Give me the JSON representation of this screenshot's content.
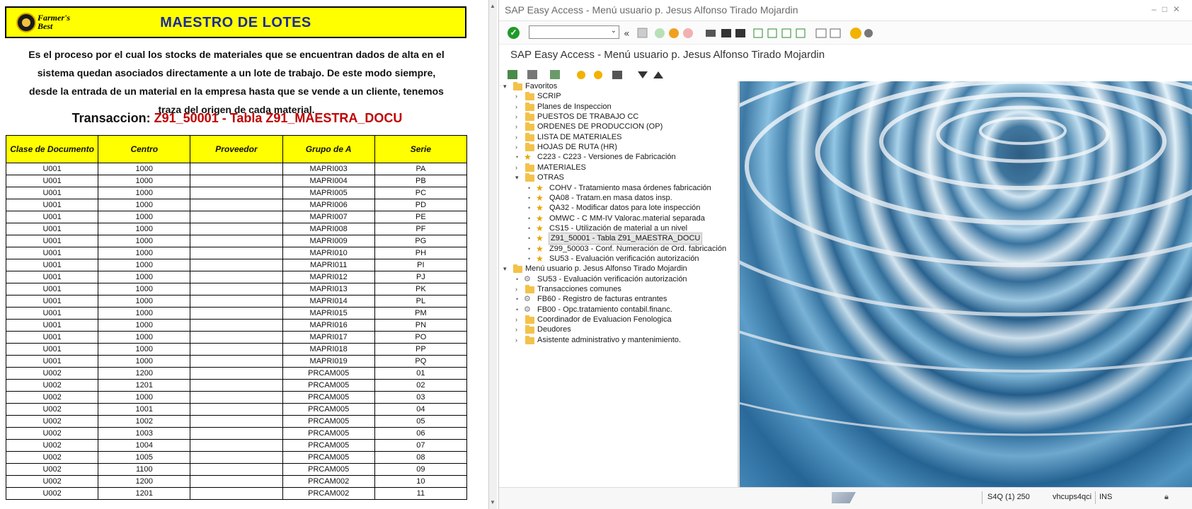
{
  "doc": {
    "logo_text": "Farmer's Best",
    "banner_title": "MAESTRO DE LOTES",
    "description_lines": [
      "Es el proceso por el cual los stocks de materiales que se encuentran dados de alta en el",
      "sistema quedan asociados directamente a un lote de trabajo. De este modo siempre,",
      "desde la entrada de un material en la empresa hasta que se vende a un cliente, tenemos",
      "traza del origen de cada material."
    ],
    "transaccion_label": "Transaccion: ",
    "transaccion_value": "Z91_50001 - Tabla Z91_MAESTRA_DOCU",
    "table": {
      "headers": [
        "Clase de Documento",
        "Centro",
        "Proveedor",
        "Grupo de A",
        "Serie"
      ],
      "rows": [
        [
          "U001",
          "1000",
          "",
          "MAPRI003",
          "PA"
        ],
        [
          "U001",
          "1000",
          "",
          "MAPRI004",
          "PB"
        ],
        [
          "U001",
          "1000",
          "",
          "MAPRI005",
          "PC"
        ],
        [
          "U001",
          "1000",
          "",
          "MAPRI006",
          "PD"
        ],
        [
          "U001",
          "1000",
          "",
          "MAPRI007",
          "PE"
        ],
        [
          "U001",
          "1000",
          "",
          "MAPRI008",
          "PF"
        ],
        [
          "U001",
          "1000",
          "",
          "MAPRI009",
          "PG"
        ],
        [
          "U001",
          "1000",
          "",
          "MAPRI010",
          "PH"
        ],
        [
          "U001",
          "1000",
          "",
          "MAPRI011",
          "PI"
        ],
        [
          "U001",
          "1000",
          "",
          "MAPRI012",
          "PJ"
        ],
        [
          "U001",
          "1000",
          "",
          "MAPRI013",
          "PK"
        ],
        [
          "U001",
          "1000",
          "",
          "MAPRI014",
          "PL"
        ],
        [
          "U001",
          "1000",
          "",
          "MAPRI015",
          "PM"
        ],
        [
          "U001",
          "1000",
          "",
          "MAPRI016",
          "PN"
        ],
        [
          "U001",
          "1000",
          "",
          "MAPRI017",
          "PO"
        ],
        [
          "U001",
          "1000",
          "",
          "MAPRI018",
          "PP"
        ],
        [
          "U001",
          "1000",
          "",
          "MAPRI019",
          "PQ"
        ],
        [
          "U002",
          "1200",
          "",
          "PRCAM005",
          "01"
        ],
        [
          "U002",
          "1201",
          "",
          "PRCAM005",
          "02"
        ],
        [
          "U002",
          "1000",
          "",
          "PRCAM005",
          "03"
        ],
        [
          "U002",
          "1001",
          "",
          "PRCAM005",
          "04"
        ],
        [
          "U002",
          "1002",
          "",
          "PRCAM005",
          "05"
        ],
        [
          "U002",
          "1003",
          "",
          "PRCAM005",
          "06"
        ],
        [
          "U002",
          "1004",
          "",
          "PRCAM005",
          "07"
        ],
        [
          "U002",
          "1005",
          "",
          "PRCAM005",
          "08"
        ],
        [
          "U002",
          "1100",
          "",
          "PRCAM005",
          "09"
        ],
        [
          "U002",
          "1200",
          "",
          "PRCAM002",
          "10"
        ],
        [
          "U002",
          "1201",
          "",
          "PRCAM002",
          "11"
        ]
      ]
    }
  },
  "sap": {
    "window_title": "SAP Easy Access  -  Menú usuario p. Jesus Alfonso Tirado Mojardin",
    "heading": "SAP Easy Access  -  Menú usuario p. Jesus Alfonso Tirado Mojardin",
    "tree": [
      {
        "label": "Favoritos",
        "type": "folder",
        "expanded": true
      },
      {
        "label": "SCRIP",
        "type": "folder"
      },
      {
        "label": "Planes de Inspeccion",
        "type": "folder"
      },
      {
        "label": "PUESTOS DE TRABAJO CC",
        "type": "folder"
      },
      {
        "label": "ORDENES DE PRODUCCION (OP)",
        "type": "folder"
      },
      {
        "label": "LISTA DE MATERIALES",
        "type": "folder"
      },
      {
        "label": "HOJAS DE RUTA (HR)",
        "type": "folder"
      },
      {
        "label": "C223 - C223 - Versiones de Fabricación",
        "type": "star"
      },
      {
        "label": "MATERIALES",
        "type": "folder"
      },
      {
        "label": "OTRAS",
        "type": "folder",
        "expanded": true
      },
      {
        "label": "COHV - Tratamiento masa órdenes fabricación",
        "type": "star2"
      },
      {
        "label": "QA08 - Tratam.en masa datos insp.",
        "type": "star2"
      },
      {
        "label": "QA32 - Modificar datos para lote inspección",
        "type": "star2"
      },
      {
        "label": "OMWC - C MM-IV Valorac.material separada",
        "type": "star2"
      },
      {
        "label": "CS15 - Utilización de material a un nivel",
        "type": "star2"
      },
      {
        "label": "Z91_50001 - Tabla Z91_MAESTRA_DOCU",
        "type": "star2",
        "selected": true
      },
      {
        "label": "Z99_50003 - Conf. Numeración de Ord. fabricación",
        "type": "star2"
      },
      {
        "label": "SU53 - Evaluación verificación autorización",
        "type": "star2"
      },
      {
        "label": "Menú usuario p. Jesus Alfonso Tirado Mojardin",
        "type": "rootfolder",
        "expanded": true
      },
      {
        "label": "SU53 - Evaluación verificación autorización",
        "type": "gear"
      },
      {
        "label": "Transacciones comunes",
        "type": "folder"
      },
      {
        "label": "FB60 - Registro de facturas entrantes",
        "type": "gear"
      },
      {
        "label": "FB00 - Opc.tratamiento contabil.financ.",
        "type": "gear"
      },
      {
        "label": "Coordinador de Evaluacion Fenologica",
        "type": "folder"
      },
      {
        "label": "Deudores",
        "type": "folder"
      },
      {
        "label": "Asistente administrativo y mantenimiento.",
        "type": "folder"
      }
    ],
    "status": {
      "system": "S4Q (1) 250",
      "host": "vhcups4qci",
      "mode": "INS"
    }
  },
  "colors": {
    "banner_yellow": "#ffff00",
    "banner_title_blue": "#1a2a9a",
    "transaction_red": "#c00000",
    "ok_green": "#1f9a2a",
    "folder_yellow": "#f3c24a"
  }
}
